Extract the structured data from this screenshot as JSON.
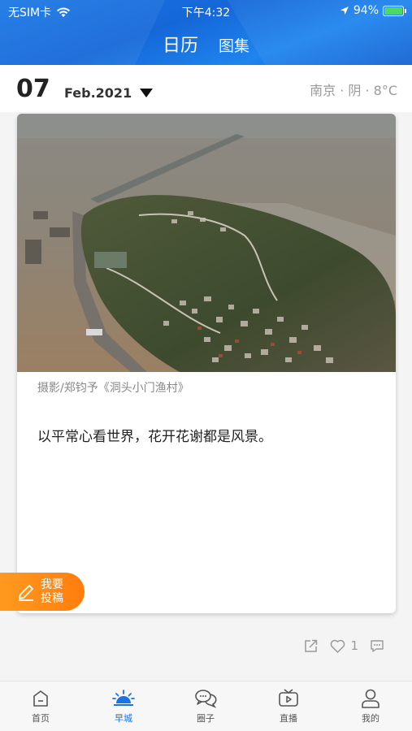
{
  "status_bar": {
    "carrier": "无SIM卡",
    "time": "下午4:32",
    "battery": "94%"
  },
  "header": {
    "tabs": [
      {
        "label": "日历",
        "active": true
      },
      {
        "label": "图集",
        "active": false
      }
    ]
  },
  "date": {
    "day": "07",
    "month": "Feb.2021"
  },
  "weather": "南京 · 阴 · 8°C",
  "card": {
    "credit": "摄影/郑钧予《洞头小门渔村》",
    "quote": "以平常心看世界，花开花谢都是风景。"
  },
  "submit": {
    "label_line1": "我要",
    "label_line2": "投稿"
  },
  "actions": {
    "likes": "1"
  },
  "bottom_nav": [
    {
      "label": "首页",
      "icon": "home-icon",
      "active": false
    },
    {
      "label": "早城",
      "icon": "sunrise-icon",
      "active": true
    },
    {
      "label": "圈子",
      "icon": "chat-bubbles-icon",
      "active": false
    },
    {
      "label": "直播",
      "icon": "tv-play-icon",
      "active": false
    },
    {
      "label": "我的",
      "icon": "user-icon",
      "active": false
    }
  ],
  "colors": {
    "brand_blue": "#1a73e8",
    "accent_orange": "#ff8a14",
    "battery_green": "#4cd964"
  }
}
